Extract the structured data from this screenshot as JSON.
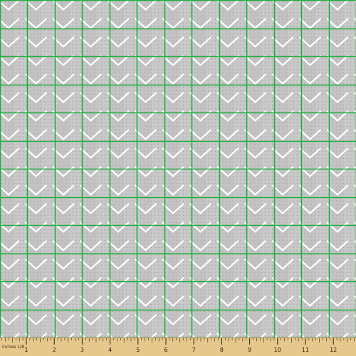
{
  "fabric": {
    "colors": {
      "background": "#c9c9c9",
      "chevron_band": "#b8b8b8",
      "dot": "#a8a8a8",
      "chevron_line": "#ffffff",
      "grid_line": "#1fae3f"
    },
    "grid_columns": 13,
    "grid_rows": 12
  },
  "ruler": {
    "caption": "inches 1/8",
    "numbers": [
      "1",
      "2",
      "3",
      "4",
      "5",
      "6",
      "7",
      "8",
      "9",
      "10",
      "11",
      "12"
    ],
    "colors": {
      "wood": "#e7c88c",
      "ink": "#2a1d08"
    }
  }
}
